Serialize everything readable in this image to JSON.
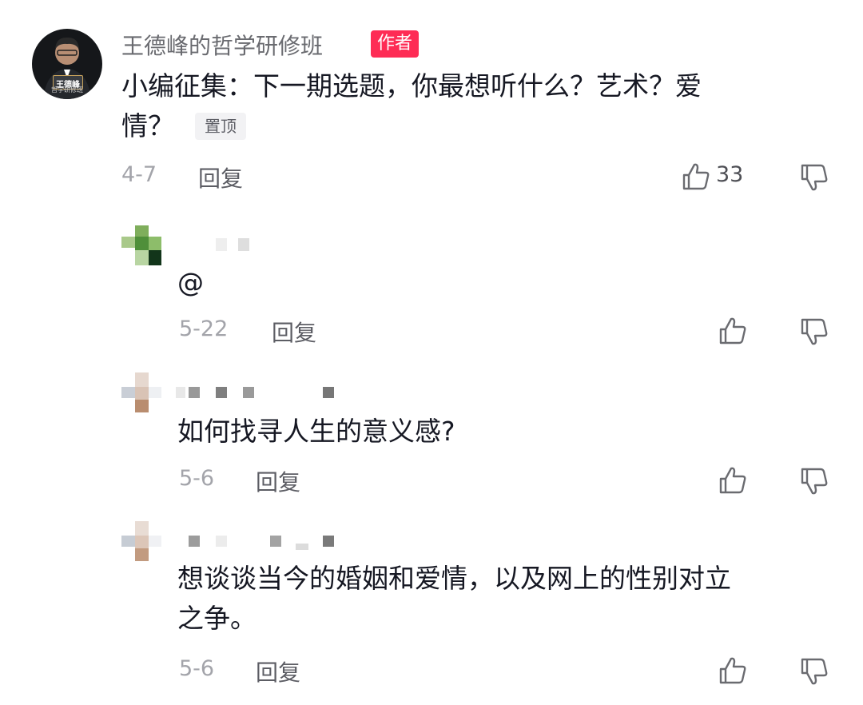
{
  "author_comment": {
    "author_name": "王德峰的哲学研修班",
    "author_badge": "作者",
    "avatar_logo": "王德峰",
    "avatar_caption": "哲学研修班",
    "text_line1": "小编征集：下一期选题，你最想听什么？艺术？爱",
    "text_line2": "情？",
    "pin_label": "置顶",
    "date": "4-7",
    "reply_label": "回复",
    "like_count": "33",
    "icons": [
      "thumbs-up-icon",
      "thumbs-down-icon"
    ]
  },
  "replies": [
    {
      "text": "@",
      "date": "5-22",
      "reply_label": "回复"
    },
    {
      "text": "如何找寻人生的意义感?",
      "date": "5-6",
      "reply_label": "回复"
    },
    {
      "text_line1": "想谈谈当今的婚姻和爱情，以及网上的性别对立",
      "text_line2": "之争。",
      "date": "5-6",
      "reply_label": "回复"
    }
  ],
  "colors": {
    "badge_red": "#fe2c55",
    "text_primary": "#161823",
    "text_secondary": "#a3a4aa"
  }
}
